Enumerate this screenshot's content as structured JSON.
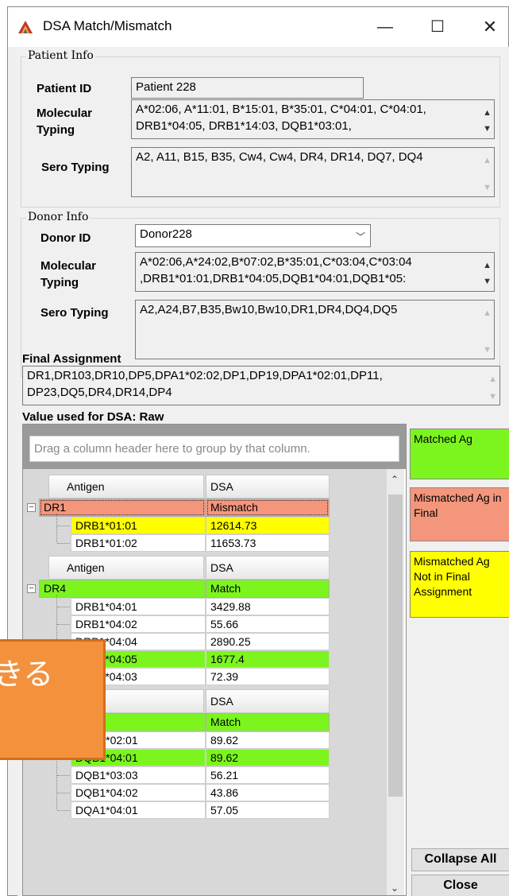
{
  "window": {
    "title": "DSA Match/Mismatch"
  },
  "patient": {
    "group_label": "Patient Info",
    "id_label": "Patient ID",
    "id_value": "Patient 228",
    "mol_label": "Molecular Typing",
    "mol_value": "A*02:06, A*11:01, B*15:01, B*35:01, C*04:01, C*04:01, DRB1*04:05, DRB1*14:03, DQB1*03:01,",
    "sero_label": "Sero Typing",
    "sero_value": "A2, A11, B15, B35, Cw4, Cw4, DR4, DR14, DQ7, DQ4"
  },
  "donor": {
    "group_label": "Donor Info",
    "id_label": "Donor ID",
    "id_value": "Donor228",
    "mol_label": "Molecular Typing",
    "mol_value": "A*02:06,A*24:02,B*07:02,B*35:01,C*03:04,C*03:04 ,DRB1*01:01,DRB1*04:05,DQB1*04:01,DQB1*05:",
    "sero_label": "Sero Typing",
    "sero_value": "A2,A24,B7,B35,Bw10,Bw10,DR1,DR4,DQ4,DQ5"
  },
  "final": {
    "label": "Final Assignment",
    "value": "DR1,DR103,DR10,DP5,DPA1*02:02,DP1,DP19,DPA1*02:01,DP11, DP23,DQ5,DR4,DR14,DP4"
  },
  "dsa_value_label": "Value used for DSA: Raw",
  "grid": {
    "group_hint": "Drag a column header here to group by that column.",
    "col_antigen": "Antigen",
    "col_dsa": "DSA",
    "groups": [
      {
        "antigen": "DR1",
        "status": "Mismatch",
        "color": "#f4967c",
        "children": [
          {
            "allele": "DRB1*01:01",
            "value": "12614.73",
            "color": "#ffff00"
          },
          {
            "allele": "DRB1*01:02",
            "value": "11653.73",
            "color": "#ffffff"
          }
        ]
      },
      {
        "antigen": "DR4",
        "status": "Match",
        "color": "#7cf51f",
        "children": [
          {
            "allele": "DRB1*04:01",
            "value": "3429.88",
            "color": "#ffffff"
          },
          {
            "allele": "DRB1*04:02",
            "value": "55.66",
            "color": "#ffffff"
          },
          {
            "allele": "DRB1*04:04",
            "value": "2890.25",
            "color": "#ffffff"
          },
          {
            "allele": "DRB1*04:05",
            "value": "1677.4",
            "color": "#7cf51f"
          },
          {
            "allele": "DRB1*04:03",
            "value": "72.39",
            "color": "#ffffff"
          }
        ]
      },
      {
        "antigen": "",
        "status": "Match",
        "color": "#7cf51f",
        "children": [
          {
            "allele": "DQB1*02:01",
            "value": "89.62",
            "color": "#ffffff"
          },
          {
            "allele": "DQB1*04:01",
            "value": "89.62",
            "color": "#7cf51f"
          },
          {
            "allele": "DQB1*03:03",
            "value": "56.21",
            "color": "#ffffff"
          },
          {
            "allele": "DQB1*04:02",
            "value": "43.86",
            "color": "#ffffff"
          },
          {
            "allele": "DQA1*04:01",
            "value": "57.05",
            "color": "#ffffff"
          }
        ]
      }
    ]
  },
  "legend": {
    "matched": "Matched Ag",
    "mismatched_final": "Mismatched Ag in Final",
    "mismatched_not_final": "Mismatched Ag Not in Final Assignment",
    "colors": {
      "matched": "#7cf51f",
      "mismatched_final": "#f4967c",
      "mismatched_not_final": "#ffff00"
    }
  },
  "buttons": {
    "collapse_all": "Collapse All",
    "close": "Close"
  },
  "overlay_text": "きる"
}
